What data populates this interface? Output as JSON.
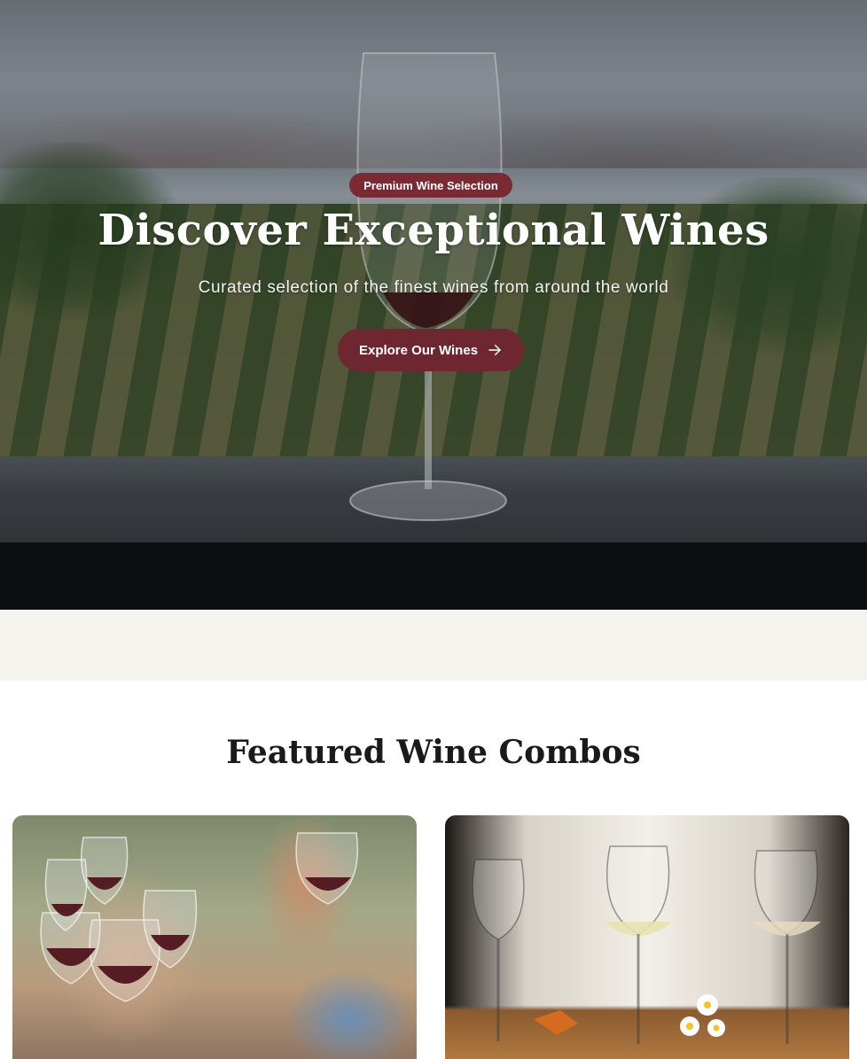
{
  "hero": {
    "badge": "Premium Wine Selection",
    "title": "Discover Exceptional Wines",
    "subtitle": "Curated selection of the finest wines from around the world",
    "cta_label": "Explore Our Wines"
  },
  "featured": {
    "title": "Featured Wine Combos"
  },
  "colors": {
    "accent": "#6e2630",
    "badge": "#7a2a33",
    "band": "#f4f3ee"
  }
}
